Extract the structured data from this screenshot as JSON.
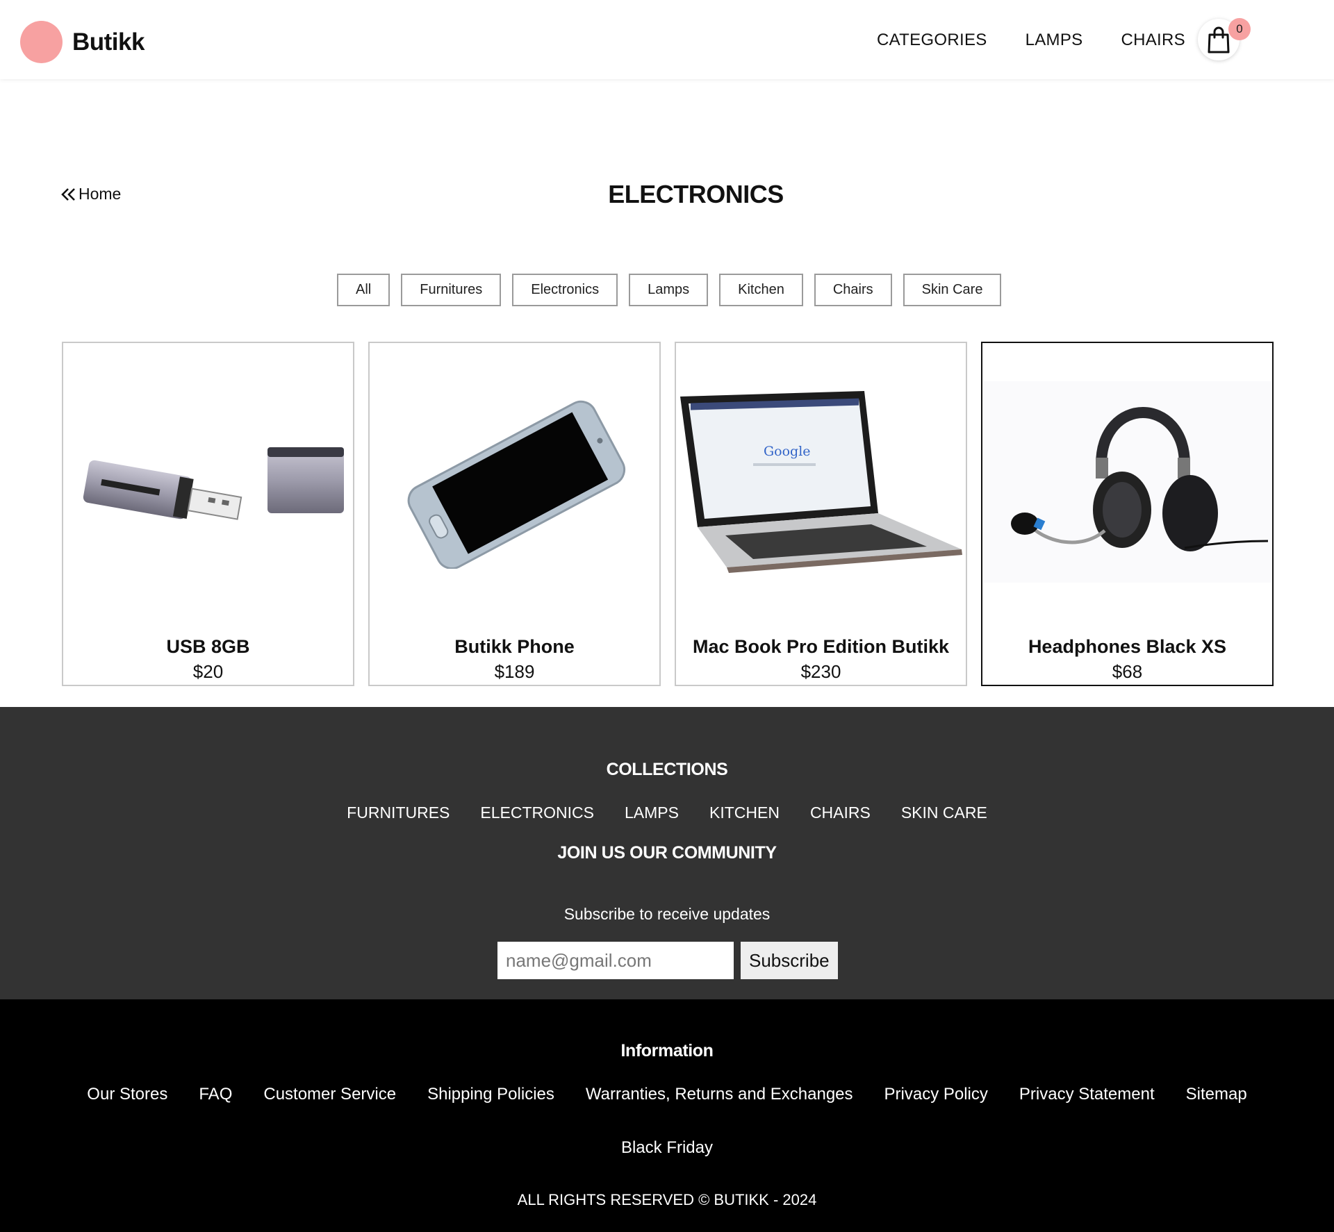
{
  "header": {
    "brand": "Butikk",
    "nav": [
      "CATEGORIES",
      "LAMPS",
      "CHAIRS"
    ],
    "cart_count": "0"
  },
  "main": {
    "back_label": "Home",
    "title": "ELECTRONICS",
    "filters": [
      "All",
      "Furnitures",
      "Electronics",
      "Lamps",
      "Kitchen",
      "Chairs",
      "Skin Care"
    ],
    "products": [
      {
        "name": "USB 8GB",
        "price": "$20",
        "image": "usb-drive-image"
      },
      {
        "name": "Butikk Phone",
        "price": "$189",
        "image": "smartphone-image"
      },
      {
        "name": "Mac Book Pro Edition Butikk",
        "price": "$230",
        "image": "laptop-image"
      },
      {
        "name": "Headphones Black XS",
        "price": "$68",
        "image": "headset-image"
      }
    ]
  },
  "footer": {
    "collections_heading": "COLLECTIONS",
    "collections": [
      "FURNITURES",
      "ELECTRONICS",
      "LAMPS",
      "KITCHEN",
      "CHAIRS",
      "SKIN CARE"
    ],
    "community_heading": "JOIN US OUR COMMUNITY",
    "subscribe_text": "Subscribe to receive updates",
    "email_placeholder": "name@gmail.com",
    "subscribe_label": "Subscribe",
    "info_heading": "Information",
    "info_links": [
      "Our Stores",
      "FAQ",
      "Customer Service",
      "Shipping Policies",
      "Warranties, Returns and Exchanges",
      "Privacy Policy",
      "Privacy Statement",
      "Sitemap"
    ],
    "extra_link": "Black Friday",
    "copyright": "ALL RIGHTS RESERVED © BUTIKK - 2024"
  },
  "colors": {
    "accent": "#f7a1a1",
    "footer_top_bg": "#333333",
    "footer_bottom_bg": "#000000"
  }
}
